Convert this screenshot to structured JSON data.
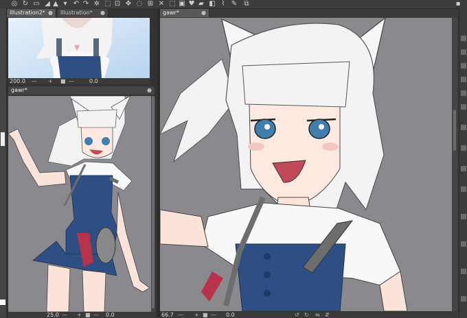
{
  "toolbar": {
    "icons": [
      "spiral-icon",
      "rotate-icon",
      "ruler-icon",
      "paint-icon",
      "undo-icon",
      "redo-icon",
      "busy-icon",
      "select-icon",
      "crop-icon",
      "transform-icon",
      "lasso-icon",
      "heart-icon",
      "fill-icon",
      "close-icon",
      "brush-icon",
      "pen-icon",
      "eraser-icon",
      "layers-icon"
    ]
  },
  "top_panel": {
    "tabs": [
      {
        "label": "Illustration2*"
      },
      {
        "label": "Illustration*"
      }
    ],
    "status": {
      "zoom": "200.0",
      "angle": "0.0"
    }
  },
  "bottom_left_panel": {
    "tab_label": "gawr*",
    "status": {
      "zoom": "25.0",
      "angle": "0.0"
    }
  },
  "main_panel": {
    "tab_label": "gawr*",
    "status": {
      "zoom": "66.7",
      "angle": "0.0"
    }
  },
  "colors": {
    "canvas_bg": "#8a898e",
    "top_canvas_bg": "#cfe3f5",
    "hair": "#f3f3f3",
    "eyes": "#3f7fae",
    "dress": "#2e4f84",
    "strap": "#6d6d6d"
  }
}
